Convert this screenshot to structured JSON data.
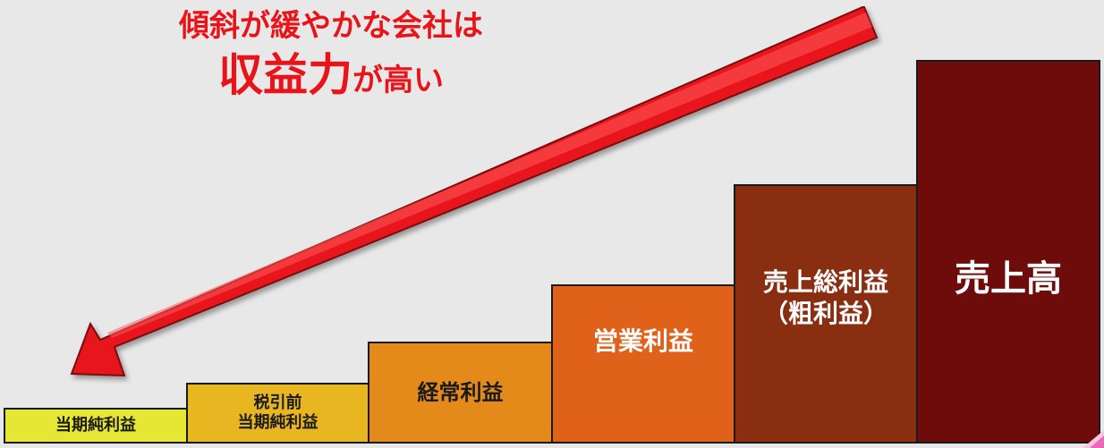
{
  "headline": {
    "line1": "傾斜が緩やかな会社は",
    "line2_emphasis": "収益力",
    "line2_rest": "が高い",
    "color": "#e8141a"
  },
  "arrow": {
    "direction": "down-left",
    "color": "#e8141a"
  },
  "steps": [
    {
      "label": "当期純利益",
      "color": "#e6e635",
      "text_color": "#1a1a1a"
    },
    {
      "label": "税引前\n当期純利益",
      "color": "#e8b620",
      "text_color": "#1a1a1a"
    },
    {
      "label": "経常利益",
      "color": "#e48a1a",
      "text_color": "#1a1a1a"
    },
    {
      "label": "営業利益",
      "color": "#e0611a",
      "text_color": "#ffffff"
    },
    {
      "label": "売上総利益\n（粗利益）",
      "color": "#8a2e12",
      "text_color": "#ffffff"
    },
    {
      "label": "売上高",
      "color": "#6e0b0b",
      "text_color": "#ffffff"
    }
  ]
}
